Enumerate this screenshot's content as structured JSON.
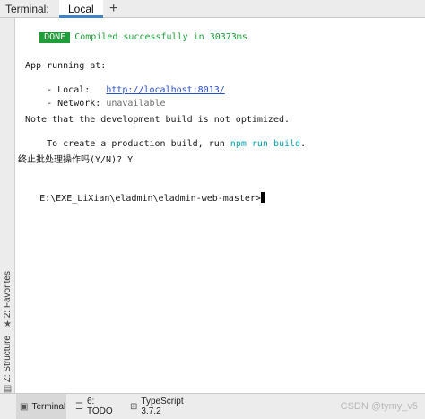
{
  "tabs": {
    "title": "Terminal:",
    "active_tab": "Local",
    "add": "+"
  },
  "sidebar": {
    "favorites": "2: Favorites",
    "structure": "Z: Structure"
  },
  "terminal": {
    "done_badge": "DONE",
    "compiled": "Compiled successfully in 30373ms",
    "app_running": "App running at:",
    "local_prefix": "- Local:   ",
    "local_url": "http://localhost:8013/",
    "network_prefix": "- Network: ",
    "network_value": "unavailable",
    "note": "Note that the development build is not optimized.",
    "build_prefix": "To create a production build, run ",
    "build_cmd": "npm run build",
    "build_suffix": ".",
    "prompt_question": "终止批处理操作吗(Y/N)? Y",
    "prompt_path": "E:\\EXE_LiXian\\eladmin\\eladmin-web-master>"
  },
  "bottom": {
    "terminal": "Terminal",
    "todo": "6: TODO",
    "typescript": "TypeScript 3.7.2",
    "watermark": "CSDN @tymy_v5"
  },
  "colors": {
    "done_bg": "#1f9e3a",
    "link": "#2a4fc4",
    "cmd": "#00a6b5"
  },
  "icons": {
    "favorites": "star-icon",
    "structure": "structure-icon",
    "terminal": "terminal-icon",
    "todo": "list-icon",
    "typescript": "typescript-icon"
  }
}
